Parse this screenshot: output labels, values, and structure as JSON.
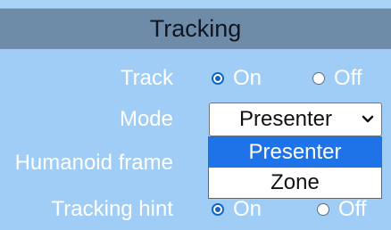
{
  "header": {
    "title": "Tracking"
  },
  "rows": {
    "track": {
      "label": "Track",
      "on": "On",
      "off": "Off",
      "selected": "On"
    },
    "mode": {
      "label": "Mode",
      "selected": "Presenter",
      "options": [
        "Presenter",
        "Zone"
      ]
    },
    "humanoid": {
      "label": "Humanoid frame"
    },
    "hint": {
      "label": "Tracking hint",
      "on": "On",
      "off": "Off",
      "selected": "On"
    }
  },
  "colors": {
    "background": "#9fcdf5",
    "header": "#6e8ca8",
    "selection": "#1e73e8"
  }
}
